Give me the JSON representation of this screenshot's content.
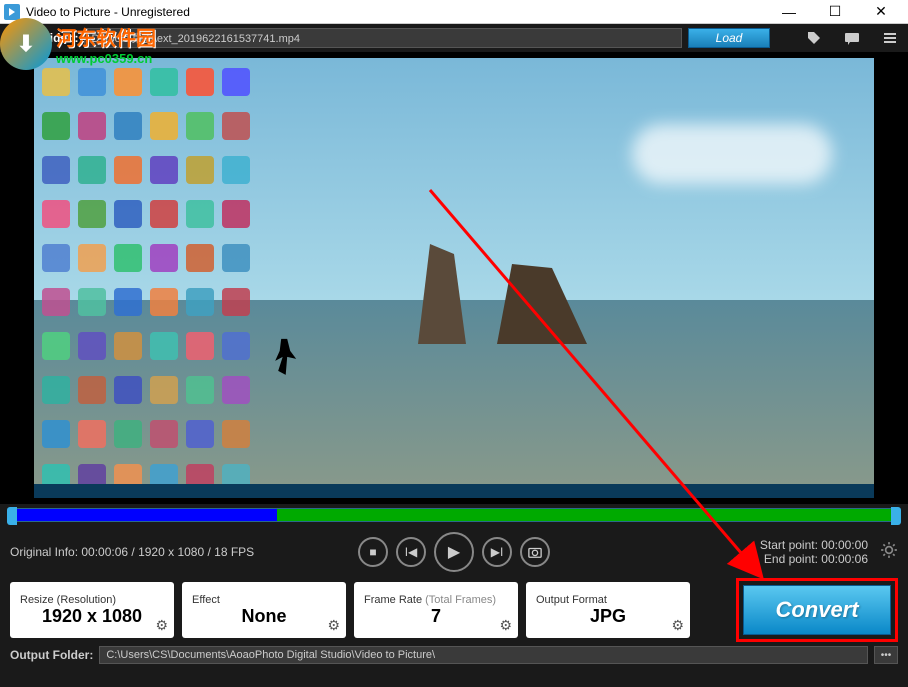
{
  "window": {
    "title": "Video to Picture - Unregistered"
  },
  "watermark": {
    "cn": "河东软件园",
    "url": "www.pc0359.cn"
  },
  "loadbar": {
    "label": "Load Video:",
    "path": "D:\\tools\\桌面\\ext_2019622161537741.mp4",
    "button": "Load"
  },
  "info": {
    "original": "Original Info: 00:00:06 / 1920 x 1080 / 18 FPS",
    "start_label": "Start point:",
    "start_value": "00:00:00",
    "end_label": "End point:",
    "end_value": "00:00:06"
  },
  "options": {
    "resize": {
      "label": "Resize (Resolution)",
      "value": "1920 x 1080"
    },
    "effect": {
      "label": "Effect",
      "value": "None"
    },
    "framerate": {
      "label": "Frame Rate",
      "sublabel": "(Total Frames)",
      "value": "7"
    },
    "format": {
      "label": "Output Format",
      "value": "JPG"
    }
  },
  "convert": {
    "label": "Convert"
  },
  "output": {
    "label": "Output Folder:",
    "path": "C:\\Users\\CS\\Documents\\AoaoPhoto Digital Studio\\Video to Picture\\"
  },
  "desktop_colors": [
    "#e8c048",
    "#4090d8",
    "#ff9030",
    "#30c0a0",
    "#ff5030",
    "#5050ff",
    "#30a040",
    "#c04080",
    "#3080c0",
    "#f0b030",
    "#50c060",
    "#c05050",
    "#4060c0",
    "#30b090",
    "#f07030",
    "#6040c0",
    "#c0a030",
    "#40b0d0",
    "#f05080",
    "#50a040",
    "#3060c0",
    "#d04040",
    "#40c0a0",
    "#c03060",
    "#5080d0",
    "#f0a050",
    "#30c070",
    "#a040c0",
    "#d06030",
    "#4090c0",
    "#c05090",
    "#50c0a0",
    "#3070d0",
    "#f08040",
    "#40a0c0",
    "#c04050",
    "#50d080",
    "#6050c0",
    "#d09040",
    "#40c0b0",
    "#f06070",
    "#5070d0",
    "#30b0a0",
    "#c06040",
    "#4050c0",
    "#d0a050",
    "#50c090",
    "#a050c0",
    "#3090d0",
    "#f07060",
    "#40b080",
    "#c05070",
    "#5060d0",
    "#d08040",
    "#30c0b0",
    "#6040a0",
    "#f09050",
    "#40a0d0",
    "#c04060",
    "#50b0c0"
  ]
}
